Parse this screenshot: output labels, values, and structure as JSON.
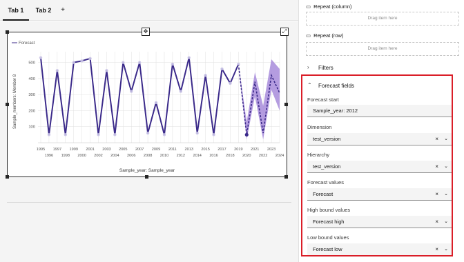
{
  "tabs": [
    "Tab 1",
    "Tab 2"
  ],
  "add_tab": "+",
  "chart_data": {
    "type": "line",
    "legend": "Forecast",
    "x": [
      1995,
      1996,
      1997,
      1998,
      1999,
      2000,
      2001,
      2002,
      2003,
      2004,
      2005,
      2006,
      2007,
      2008,
      2009,
      2010,
      2011,
      2012,
      2013,
      2014,
      2015,
      2016,
      2017,
      2018,
      2019,
      2020,
      2021,
      2022,
      2023,
      2024
    ],
    "x_tick_labels_top": [
      "1995",
      "1997",
      "1999",
      "2001",
      "2003",
      "2005",
      "2007",
      "2009",
      "2011",
      "2013",
      "2015",
      "2017",
      "2019",
      "2021",
      "2023"
    ],
    "x_tick_labels_bottom": [
      "1996",
      "1998",
      "2000",
      "2002",
      "2004",
      "2006",
      "2008",
      "2010",
      "2012",
      "2014",
      "2016",
      "2018",
      "2020",
      "2022",
      "2024"
    ],
    "y_ticks": [
      "100",
      "200",
      "300",
      "400",
      "500"
    ],
    "ylim": [
      0,
      550
    ],
    "xlabel": "Sample_year: Sample_year",
    "ylabel": "Sample_members: Member 8",
    "series": [
      {
        "values": [
          530,
          50,
          450,
          50,
          500,
          510,
          525,
          50,
          450,
          50,
          500,
          320,
          500,
          60,
          250,
          50,
          490,
          320,
          530,
          60,
          420,
          50,
          460,
          370,
          490,
          null,
          null,
          null,
          null,
          null
        ]
      }
    ],
    "forecast": {
      "x": [
        2019,
        2020,
        2021,
        2022,
        2023,
        2024
      ],
      "values": [
        490,
        50,
        380,
        60,
        420,
        310
      ],
      "high": [
        490,
        130,
        440,
        230,
        520,
        460
      ],
      "low": [
        490,
        20,
        290,
        20,
        330,
        200
      ]
    },
    "colors": {
      "line": "#3b2a8a",
      "band": "#a78bdb",
      "grid": "#e0e0e0"
    }
  },
  "panel": {
    "repeat_column": "Repeat (column)",
    "repeat_row": "Repeat (row)",
    "drop_placeholder": "Drag item here",
    "filters": "Filters",
    "forecast_fields": "Forecast fields",
    "forecast_start_label": "Forecast start",
    "forecast_start_value": "Sample_year: 2012",
    "dimension_label": "Dimension",
    "dimension_value": "test_version",
    "hierarchy_label": "Hierarchy",
    "hierarchy_value": "test_version",
    "forecast_values_label": "Forecast values",
    "forecast_values_value": "Forecast",
    "high_bound_label": "High bound values",
    "high_bound_value": "Forecast high",
    "low_bound_label": "Low bound values",
    "low_bound_value": "Forecast low",
    "clear_glyph": "×",
    "dropdown_glyph": "⌄"
  },
  "colors": {
    "highlight_box": "#da1e28"
  }
}
